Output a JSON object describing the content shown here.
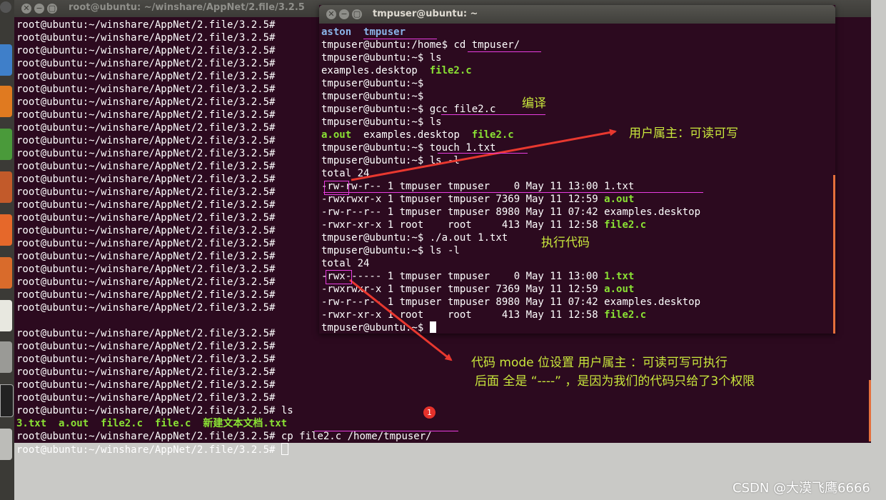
{
  "back_window": {
    "title": "root@ubuntu: ~/winshare/AppNet/2.file/3.2.5",
    "lines": [
      "root@ubuntu:~/winshare/AppNet/2.file/3.2.5#",
      "root@ubuntu:~/winshare/AppNet/2.file/3.2.5#",
      "root@ubuntu:~/winshare/AppNet/2.file/3.2.5#",
      "root@ubuntu:~/winshare/AppNet/2.file/3.2.5#",
      "root@ubuntu:~/winshare/AppNet/2.file/3.2.5#",
      "root@ubuntu:~/winshare/AppNet/2.file/3.2.5#",
      "root@ubuntu:~/winshare/AppNet/2.file/3.2.5#",
      "root@ubuntu:~/winshare/AppNet/2.file/3.2.5#",
      "root@ubuntu:~/winshare/AppNet/2.file/3.2.5#",
      "root@ubuntu:~/winshare/AppNet/2.file/3.2.5#",
      "root@ubuntu:~/winshare/AppNet/2.file/3.2.5#",
      "root@ubuntu:~/winshare/AppNet/2.file/3.2.5#",
      "root@ubuntu:~/winshare/AppNet/2.file/3.2.5#",
      "root@ubuntu:~/winshare/AppNet/2.file/3.2.5#",
      "root@ubuntu:~/winshare/AppNet/2.file/3.2.5#",
      "root@ubuntu:~/winshare/AppNet/2.file/3.2.5#",
      "root@ubuntu:~/winshare/AppNet/2.file/3.2.5#",
      "root@ubuntu:~/winshare/AppNet/2.file/3.2.5#",
      "root@ubuntu:~/winshare/AppNet/2.file/3.2.5#",
      "root@ubuntu:~/winshare/AppNet/2.file/3.2.5#",
      "root@ubuntu:~/winshare/AppNet/2.file/3.2.5#",
      "root@ubuntu:~/winshare/AppNet/2.file/3.2.5#",
      "root@ubuntu:~/winshare/AppNet/2.file/3.2.5#",
      "",
      "root@ubuntu:~/winshare/AppNet/2.file/3.2.5#",
      "root@ubuntu:~/winshare/AppNet/2.file/3.2.5#",
      "root@ubuntu:~/winshare/AppNet/2.file/3.2.5#",
      "root@ubuntu:~/winshare/AppNet/2.file/3.2.5#",
      "root@ubuntu:~/winshare/AppNet/2.file/3.2.5#",
      "root@ubuntu:~/winshare/AppNet/2.file/3.2.5#",
      "root@ubuntu:~/winshare/AppNet/2.file/3.2.5# ls"
    ],
    "ls_files": [
      "3.txt",
      "a.out",
      "file2.c",
      "file.c",
      "新建文本文档.txt"
    ],
    "cp_prompt": "root@ubuntu:~/winshare/AppNet/2.file/3.2.5#",
    "cp_command": "cp file2.c /home/tmpuser/",
    "last_prompt": "root@ubuntu:~/winshare/AppNet/2.file/3.2.5#"
  },
  "front_window": {
    "title": "tmpuser@ubuntu: ~",
    "users": [
      "aston",
      "tmpuser"
    ],
    "lines": [
      {
        "p": "tmpuser@ubuntu:/home$ ",
        "c": "cd tmpuser/"
      },
      {
        "p": "tmpuser@ubuntu:~$ ",
        "c": "ls"
      },
      {
        "p": "tmpuser@ubuntu:~$ ",
        "c": ""
      },
      {
        "p": "tmpuser@ubuntu:~$ ",
        "c": ""
      },
      {
        "p": "tmpuser@ubuntu:~$ ",
        "c": "gcc file2.c"
      },
      {
        "p": "tmpuser@ubuntu:~$ ",
        "c": "ls"
      },
      {
        "p": "tmpuser@ubuntu:~$ ",
        "c": "touch 1.txt"
      },
      {
        "p": "tmpuser@ubuntu:~$ ",
        "c": "ls -l"
      },
      {
        "p": "tmpuser@ubuntu:~$ ",
        "c": "./a.out 1.txt"
      },
      {
        "p": "tmpuser@ubuntu:~$ ",
        "c": "ls -l"
      }
    ],
    "ls1": {
      "plain": "examples.desktop",
      "exec": "file2.c"
    },
    "ls2": {
      "exec1": "a.out",
      "plain": "examples.desktop",
      "exec2": "file2.c"
    },
    "total": "total 24",
    "listing1": [
      {
        "meta": "-rw-rw-r-- 1 tmpuser tmpuser    0 May 11 13:00 ",
        "name": "1.txt",
        "green": false
      },
      {
        "meta": "-rwxrwxr-x 1 tmpuser tmpuser 7369 May 11 12:59 ",
        "name": "a.out",
        "green": true
      },
      {
        "meta": "-rw-r--r-- 1 tmpuser tmpuser 8980 May 11 07:42 ",
        "name": "examples.desktop",
        "green": false
      },
      {
        "meta": "-rwxr-xr-x 1 root    root     413 May 11 12:58 ",
        "name": "file2.c",
        "green": true
      }
    ],
    "listing2": [
      {
        "meta": "-rwx------ 1 tmpuser tmpuser    0 May 11 13:00 ",
        "name": "1.txt",
        "green": true
      },
      {
        "meta": "-rwxrwxr-x 1 tmpuser tmpuser 7369 May 11 12:59 ",
        "name": "a.out",
        "green": true
      },
      {
        "meta": "-rw-r--r-- 1 tmpuser tmpuser 8980 May 11 07:42 ",
        "name": "examples.desktop",
        "green": false
      },
      {
        "meta": "-rwxr-xr-x 1 root    root     413 May 11 12:58 ",
        "name": "file2.c",
        "green": true
      }
    ],
    "final_prompt": "tmpuser@ubuntu:~$ "
  },
  "annotations": {
    "compile": "编译",
    "owner_rw": "用户属主：可读可写",
    "exec_code": "执行代码",
    "mode_note_1": "代码 mode 位设置 用户属主 ：可读可写可执行",
    "mode_note_2": "后面 全是 “----” ，是因为我们的代码只给了3个权限",
    "badge": "1"
  },
  "watermark": "CSDN @大漠飞鹰6666",
  "colors": {
    "terminal_bg": "#2c0a1f",
    "exec_green": "#8ae234",
    "annotation_pink": "#e83de0",
    "annotation_text": "#c8e63c",
    "arrow_red": "#e8382f"
  }
}
